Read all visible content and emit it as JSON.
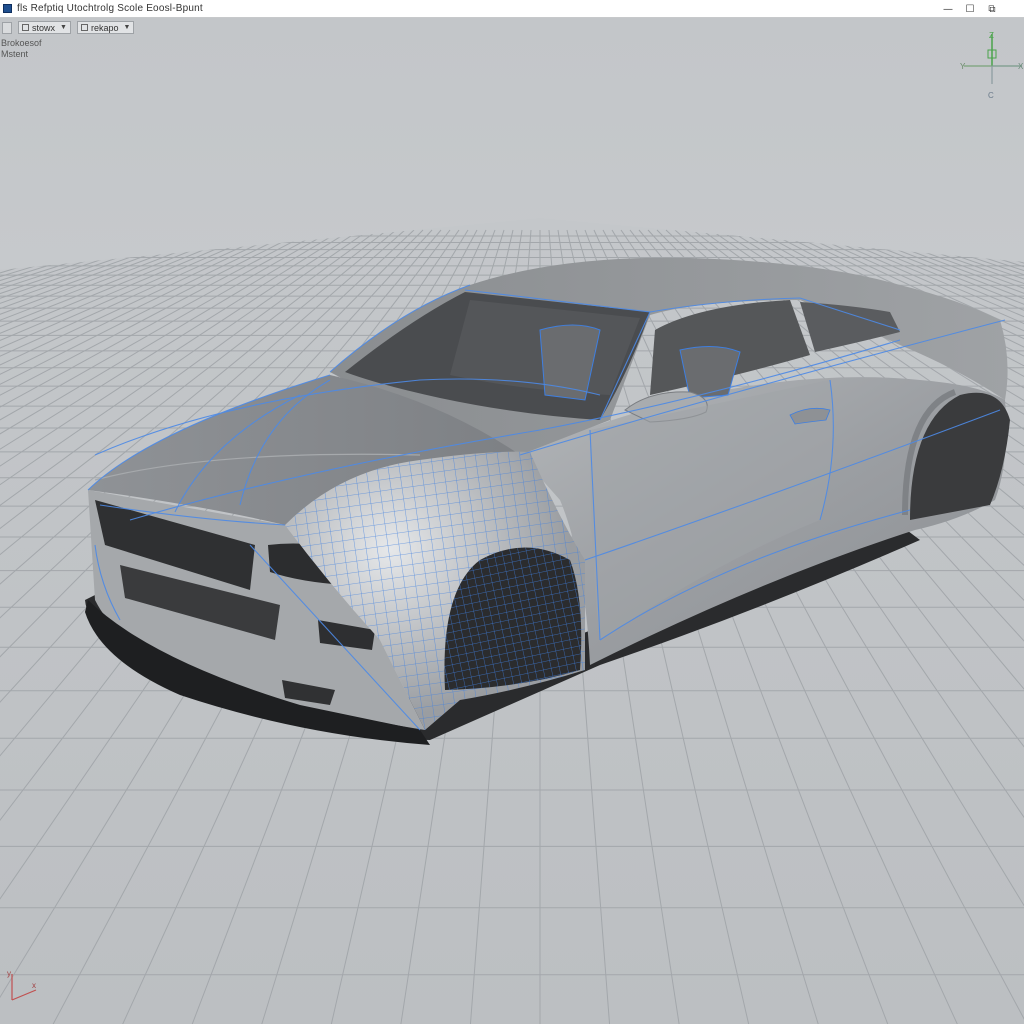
{
  "window": {
    "title": "fls  Refptiq  Utochtrolg  Scole  Eoosl-Bpunt",
    "controls": {
      "minimize": "—",
      "maximize": "☐",
      "restore": "⧉"
    }
  },
  "toolbar": {
    "view_dropdown": {
      "value": "stowx"
    },
    "shading_dropdown": {
      "value": "rekapo"
    }
  },
  "overlay": {
    "line1": "Brokoesof",
    "line2": "Mstent"
  },
  "gizmo": {
    "top_label": "Z",
    "left_label": "Y",
    "right_label": "X",
    "bottom_label": "C"
  },
  "axis_indicator": {
    "x_label": "x",
    "y_label": "y"
  },
  "colors": {
    "background_top": "#c7cacd",
    "grid_floor": "#b9bcbf",
    "grid_line": "#9fa3a7",
    "car_body": "#9ea1a5",
    "wireframe": "#3f7fe0",
    "gizmo_green": "#4aa34a"
  }
}
